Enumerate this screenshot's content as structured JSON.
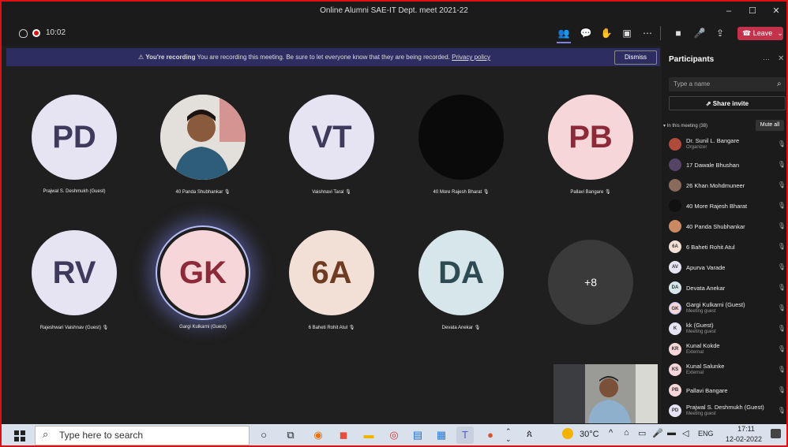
{
  "window": {
    "title": "Online Alumni SAE-IT Dept. meet 2021-22",
    "minimize": "–",
    "maximize": "☐",
    "close": "✕"
  },
  "toolbar": {
    "timer": "10:02",
    "leave_label": "Leave"
  },
  "banner": {
    "lead": "You're recording",
    "text": "You are recording this meeting. Be sure to let everyone know that they are being recorded.",
    "link": "Privacy policy",
    "dismiss": "Dismiss"
  },
  "tiles": [
    {
      "initials": "PD",
      "name": "Prajwal S. Deshmukh (Guest)",
      "color": "#e6e3f3",
      "text": "#3e3a5c"
    },
    {
      "initials": "",
      "name": "40 Panda Shubhankar",
      "color": "#c98a63",
      "text": "#333"
    },
    {
      "initials": "VT",
      "name": "Vaishnavi Taral",
      "color": "#e6e3f3",
      "text": "#3e3a5c"
    },
    {
      "initials": "",
      "name": "40 More Rajesh Bharat",
      "color": "#0a0a0a",
      "text": "#333"
    },
    {
      "initials": "PB",
      "name": "Pallavi Bangare",
      "color": "#f6d6d8",
      "text": "#8c2a3a"
    },
    {
      "initials": "RV",
      "name": "Rajeshwari Vaishnav (Guest)",
      "color": "#e6e3f3",
      "text": "#3e3a5c"
    },
    {
      "initials": "GK",
      "name": "Gargi Kulkarni (Guest)",
      "color": "#f6d6d8",
      "text": "#8c2a3a"
    },
    {
      "initials": "6A",
      "name": "6 Baheti Rohit Atul",
      "color": "#f2e0d6",
      "text": "#6e3c22"
    },
    {
      "initials": "DA",
      "name": "Devata Anekar",
      "color": "#d7e6ea",
      "text": "#2e4a52"
    },
    {
      "initials": "+8",
      "name": "",
      "color": "#3a3a3a",
      "text": "#ffffff"
    }
  ],
  "participants": {
    "title": "Participants",
    "search_placeholder": "Type a name",
    "share": "Share invite",
    "in_meeting": "In this meeting (38)",
    "mute_all": "Mute all",
    "list": [
      {
        "initials": "",
        "name": "Dr. Sunil L. Bangare",
        "sub": "Organizer",
        "color": "#b04a3a"
      },
      {
        "initials": "",
        "name": "17 Dawale Bhushan",
        "sub": "",
        "color": "#554466"
      },
      {
        "initials": "",
        "name": "26 Khan Mohdmuneer",
        "sub": "",
        "color": "#8a6a5a"
      },
      {
        "initials": "",
        "name": "40 More Rajesh Bharat",
        "sub": "",
        "color": "#111111"
      },
      {
        "initials": "",
        "name": "40 Panda Shubhankar",
        "sub": "",
        "color": "#c98a63"
      },
      {
        "initials": "6A",
        "name": "6 Baheti Rohit Atul",
        "sub": "",
        "color": "#f2e0d6"
      },
      {
        "initials": "AV",
        "name": "Apurva Varade",
        "sub": "",
        "color": "#e6e3f3"
      },
      {
        "initials": "DA",
        "name": "Devata Anekar",
        "sub": "",
        "color": "#d7e6ea"
      },
      {
        "initials": "GK",
        "name": "Gargi Kulkarni (Guest)",
        "sub": "Meeting guest",
        "color": "#f6d6d8"
      },
      {
        "initials": "K",
        "name": "kk (Guest)",
        "sub": "Meeting guest",
        "color": "#e6e3f3"
      },
      {
        "initials": "KR",
        "name": "Kunal Kokde",
        "sub": "External",
        "color": "#f6d6d8"
      },
      {
        "initials": "KS",
        "name": "Kunal Salunke",
        "sub": "External",
        "color": "#f6d6d8"
      },
      {
        "initials": "PB",
        "name": "Pallavi Bangare",
        "sub": "",
        "color": "#f6d6d8"
      },
      {
        "initials": "PD",
        "name": "Prajwal S. Deshmukh (Guest)",
        "sub": "Meeting guest",
        "color": "#e6e3f3"
      }
    ]
  },
  "taskbar": {
    "search_placeholder": "Type here to search",
    "temp": "30°C",
    "lang": "ENG",
    "time": "17:11",
    "date": "12-02-2022"
  }
}
